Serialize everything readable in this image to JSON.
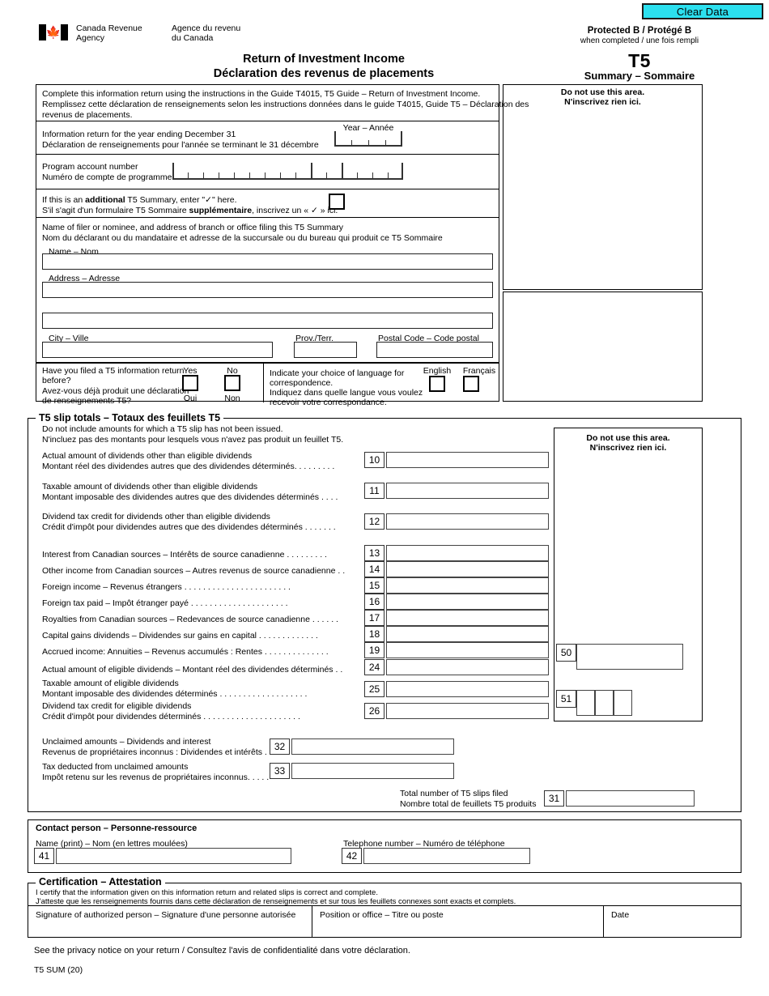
{
  "toolbar": {
    "clear_data": "Clear Data"
  },
  "agency": {
    "en_line1": "Canada Revenue",
    "en_line2": "Agency",
    "fr_line1": "Agence du revenu",
    "fr_line2": "du Canada"
  },
  "header": {
    "protected": "Protected B / Protégé B",
    "protected_sub": "when completed / une fois rempli",
    "form_code": "T5",
    "form_sub": "Summary – Sommaire",
    "title_en": "Return of Investment Income",
    "title_fr": "Déclaration des revenus de placements"
  },
  "instructions": {
    "line1": "Complete this information return using the instructions in the Guide T4015, T5 Guide – Return of Investment Income.",
    "line2": "Remplissez cette déclaration de renseignements selon les instructions données dans le guide T4015, Guide T5 – Déclaration des",
    "line3": "revenus de placements."
  },
  "year_row": {
    "label_en": "Information return for the year ending December 31",
    "label_fr": "Déclaration de renseignements pour l'année se terminant le 31 décembre",
    "year_caption": "Year – Année",
    "year_cells": 4,
    "year_value": ""
  },
  "program_account": {
    "label_en": "Program account number",
    "label_fr": "Numéro de compte de programme",
    "cells": 15,
    "value": ""
  },
  "additional": {
    "line1_a": "If this is an ",
    "line1_b": "additional",
    "line1_c": " T5 Summary, enter \"✓\" here.",
    "line2_a": "S'il s'agit d'un formulaire T5 Sommaire ",
    "line2_b": "supplémentaire",
    "line2_c": ", inscrivez un « ✓ » ici.",
    "checked": false
  },
  "filer": {
    "head_en": "Name of filer or nominee, and address of branch or office filing this T5 Summary",
    "head_fr": "Nom du déclarant ou du mandataire et adresse de la succursale ou du bureau qui produit ce T5 Sommaire",
    "name_label": "Name – Nom",
    "name_value": "",
    "address_label": "Address – Adresse",
    "address_value": "",
    "address2_value": "",
    "city_label": "City – Ville",
    "city_value": "",
    "prov_label": "Prov./Terr.",
    "prov_value": "",
    "postal_label": "Postal Code – Code postal",
    "postal_value": ""
  },
  "filed_before": {
    "q_en_l1": "Have you filed a T5 information return",
    "q_en_l2": "before?",
    "q_fr_l1": "Avez-vous déjà produit une déclaration",
    "q_fr_l2": "de renseignements T5?",
    "yes": "Yes",
    "no": "No",
    "oui": "Oui",
    "non": "Non",
    "yes_checked": false,
    "no_checked": false
  },
  "language": {
    "q_en_l1": "Indicate your choice of language for",
    "q_en_l2": "correspondence.",
    "q_fr_l1": "Indiquez dans quelle langue vous voulez",
    "q_fr_l2": "recevoir votre correspondance.",
    "english": "English",
    "francais": "Français",
    "english_checked": false,
    "francais_checked": false
  },
  "do_not_use": {
    "line1": "Do not use this area.",
    "line2": "N'inscrivez rien ici."
  },
  "slip_totals": {
    "legend": "T5 slip totals – Totaux des feuillets T5",
    "note_en": "Do not include amounts for which a T5 slip has not been issued.",
    "note_fr": "N'incluez pas des montants pour lesquels vous n'avez pas produit un feuillet T5.",
    "rows": [
      {
        "box": "10",
        "en": "Actual amount of dividends other than eligible dividends",
        "fr": "Montant réel des dividendes autres que des dividendes déterminés.",
        "leader": ". . . . . . . .",
        "value": "",
        "style": "two"
      },
      {
        "box": "11",
        "en": "Taxable amount of dividends other than eligible dividends",
        "fr": "Montant imposable des dividendes autres que des dividendes déterminés",
        "leader": ". . . .",
        "value": "",
        "style": "two"
      },
      {
        "box": "12",
        "en": "Dividend tax credit for dividends other than eligible dividends",
        "fr": "Crédit d'impôt pour dividendes autres que des dividendes déterminés",
        "leader": ". . . . . . .",
        "value": "",
        "style": "two"
      },
      {
        "box": "13",
        "en": "Interest from Canadian sources – Intérêts de source canadienne",
        "fr": "",
        "leader": ". . . . . . . . .",
        "value": "",
        "style": "one"
      },
      {
        "box": "14",
        "en": "Other income from Canadian sources – Autres revenus de source canadienne",
        "fr": "",
        "leader": ". .",
        "value": "",
        "style": "one"
      },
      {
        "box": "15",
        "en": "Foreign income – Revenus étrangers",
        "fr": "",
        "leader": ". . . . . . . . . . . . . . . . . . . . . . .",
        "value": "",
        "style": "one"
      },
      {
        "box": "16",
        "en": "Foreign tax paid – Impôt étranger payé",
        "fr": "",
        "leader": ". . . . . . . . . . . . . . . . . . . . .",
        "value": "",
        "style": "one"
      },
      {
        "box": "17",
        "en": "Royalties from Canadian sources – Redevances de source canadienne",
        "fr": "",
        "leader": ". . . . . .",
        "value": "",
        "style": "one"
      },
      {
        "box": "18",
        "en": "Capital gains dividends – Dividendes sur gains en capital",
        "fr": "",
        "leader": ". . . . . . . . . . . . .",
        "value": "",
        "style": "one"
      },
      {
        "box": "19",
        "en": "Accrued income: Annuities – Revenus accumulés : Rentes",
        "fr": "",
        "leader": ". . . . . . . . . . . . . .",
        "value": "",
        "style": "one"
      },
      {
        "box": "24",
        "en": "Actual amount of eligible dividends – Montant réel des dividendes déterminés",
        "fr": "",
        "leader": ". .",
        "value": "",
        "style": "one"
      },
      {
        "box": "25",
        "en": "Taxable amount of eligible dividends",
        "fr": "Montant imposable des dividendes déterminés",
        "leader": ". . . . . . . . . . . . . . . . . . .",
        "value": "",
        "style": "two"
      },
      {
        "box": "26",
        "en": "Dividend tax credit for eligible dividends",
        "fr": "Crédit d'impôt pour dividendes déterminés",
        "leader": ". . . . . . . . . . . . . . . . . . . . .",
        "value": "",
        "style": "two"
      }
    ],
    "unclaimed": [
      {
        "box": "32",
        "en": "Unclaimed amounts – Dividends and interest",
        "fr": "Revenus de propriétaires inconnus : Dividendes et intérêts",
        "leader": ".",
        "value": ""
      },
      {
        "box": "33",
        "en": "Tax deducted from unclaimed amounts",
        "fr": "Impôt retenu sur les revenus de propriétaires inconnus.",
        "leader": ". . . .",
        "value": ""
      }
    ],
    "total_slips": {
      "en": "Total number of T5 slips filed",
      "fr": "Nombre total de feuillets T5 produits",
      "box": "31",
      "value": ""
    },
    "office_boxes": [
      {
        "box": "50",
        "value": "",
        "cells": 1
      },
      {
        "box": "51",
        "value": "",
        "cells": 3
      }
    ]
  },
  "contact": {
    "legend": "Contact person – Personne-ressource",
    "name_label": "Name (print) – Nom (en lettres moulées)",
    "name_box": "41",
    "name_value": "",
    "phone_label": "Telephone number – Numéro de téléphone",
    "phone_box": "42",
    "phone_value": ""
  },
  "certification": {
    "legend": "Certification – Attestation",
    "line_en": "I certify that the information given on this information return and related slips is correct and complete.",
    "line_fr": "J'atteste que les renseignements fournis dans cette déclaration de renseignements et sur tous les feuillets connexes sont exacts et complets.",
    "signature_label": "Signature of authorized person – Signature d'une personne autorisée",
    "signature_value": "",
    "position_label": "Position or office – Titre ou poste",
    "position_value": "",
    "date_label": "Date",
    "date_value": ""
  },
  "footer": {
    "privacy": "See the privacy notice on your return / Consultez l'avis de confidentialité dans votre déclaration.",
    "form_id": "T5 SUM (20)"
  },
  "colors": {
    "clear_button_bg": "#2ce0ef",
    "border": "#000000",
    "field_border": "#444444"
  }
}
